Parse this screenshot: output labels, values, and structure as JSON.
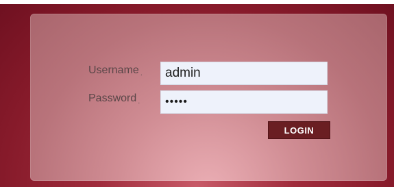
{
  "login_form": {
    "username_label": "Username",
    "username_separator": ".",
    "username_value": "admin",
    "password_label": "Password",
    "password_separator": ".",
    "password_value": "•••••",
    "login_button": "LOGIN"
  },
  "colors": {
    "background": "#8c1e2e",
    "panel": "#d29aa0",
    "button": "#6a1e22",
    "input": "#eef2fb"
  }
}
